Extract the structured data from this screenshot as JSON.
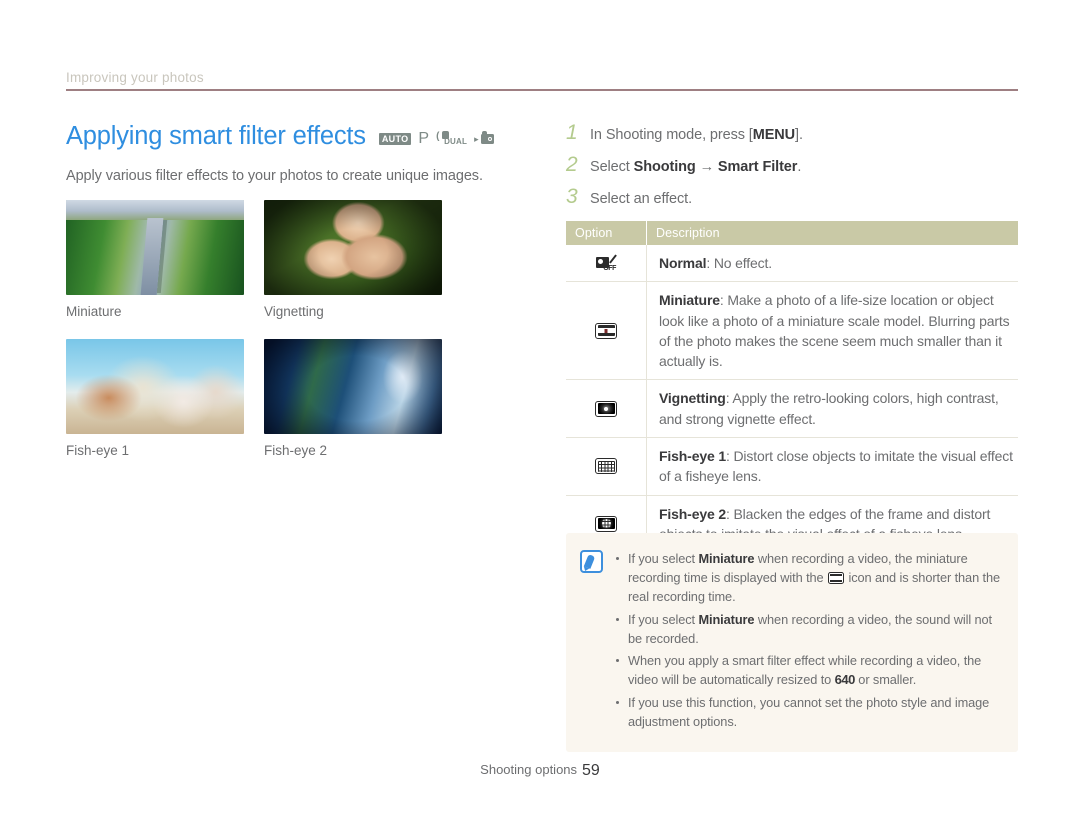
{
  "running_head": "Improving your photos",
  "section": {
    "title": "Applying smart filter effects",
    "intro": "Apply various filter effects to your photos to create unique images.",
    "mode_icons": {
      "auto_label": "AUTO",
      "program_label": "P",
      "dual_label": "DUAL",
      "video_label": ""
    }
  },
  "samples": [
    {
      "caption": "Miniature",
      "image": "aerial-highway-through-green-trees"
    },
    {
      "caption": "Vignetting",
      "image": "three-faces-lying-on-grass"
    },
    {
      "caption": "Fish-eye 1",
      "image": "family-running-on-beach"
    },
    {
      "caption": "Fish-eye 2",
      "image": "blue-toned-shop-street"
    }
  ],
  "steps": [
    {
      "num": "1",
      "pre": "In Shooting mode, press [",
      "bold": "MENU",
      "post": "]."
    },
    {
      "num": "2",
      "pre": "Select ",
      "bold": "Shooting",
      "mid": " → ",
      "bold2": "Smart Filter",
      "post": "."
    },
    {
      "num": "3",
      "pre": "Select an effect.",
      "bold": "",
      "post": ""
    }
  ],
  "table": {
    "headers": {
      "option": "Option",
      "description": "Description"
    },
    "rows": [
      {
        "icon": "filter-off-icon",
        "name": "Normal",
        "text": ": No effect."
      },
      {
        "icon": "miniature-icon",
        "name": "Miniature",
        "text": ": Make a photo of a life-size location or object look like a photo of a miniature scale model. Blurring parts of the photo makes the scene seem much smaller than it actually is."
      },
      {
        "icon": "vignetting-icon",
        "name": "Vignetting",
        "text": ": Apply the retro-looking colors, high contrast, and strong vignette effect."
      },
      {
        "icon": "fisheye1-icon",
        "name": "Fish-eye 1",
        "text": ": Distort close objects to imitate the visual effect of a fisheye lens."
      },
      {
        "icon": "fisheye2-icon",
        "name": "Fish-eye 2",
        "text": ": Blacken the edges of the frame and distort objects to imitate the visual effect of a fisheye lens."
      }
    ]
  },
  "note": {
    "icon": "note-pen-icon",
    "bullets": [
      {
        "p1": "If you select ",
        "b1": "Miniature",
        "p2": " when recording a video, the miniature recording time is displayed with the ",
        "inline_icon": "miniature-icon",
        "p3": " icon and is shorter than the real recording time."
      },
      {
        "p1": "If you select ",
        "b1": "Miniature",
        "p2": " when recording a video, the sound will not be recorded.",
        "p3": ""
      },
      {
        "p1": "When you apply a smart filter effect while recording a video, the video will be automatically resized to ",
        "b1": "640",
        "p2": " or smaller.",
        "p3": ""
      },
      {
        "p1": "If you use this function, you cannot set the photo style and image adjustment options.",
        "b1": "",
        "p2": "",
        "p3": ""
      }
    ]
  },
  "footer": {
    "label": "Shooting options",
    "page": "59"
  },
  "colors": {
    "title_blue": "#2f8ee0",
    "rule": "#9e7f82",
    "table_header": "#c9c9a6",
    "step_number": "#b4cb8e",
    "note_bg": "#faf6ef",
    "note_icon": "#3d8fdd"
  }
}
